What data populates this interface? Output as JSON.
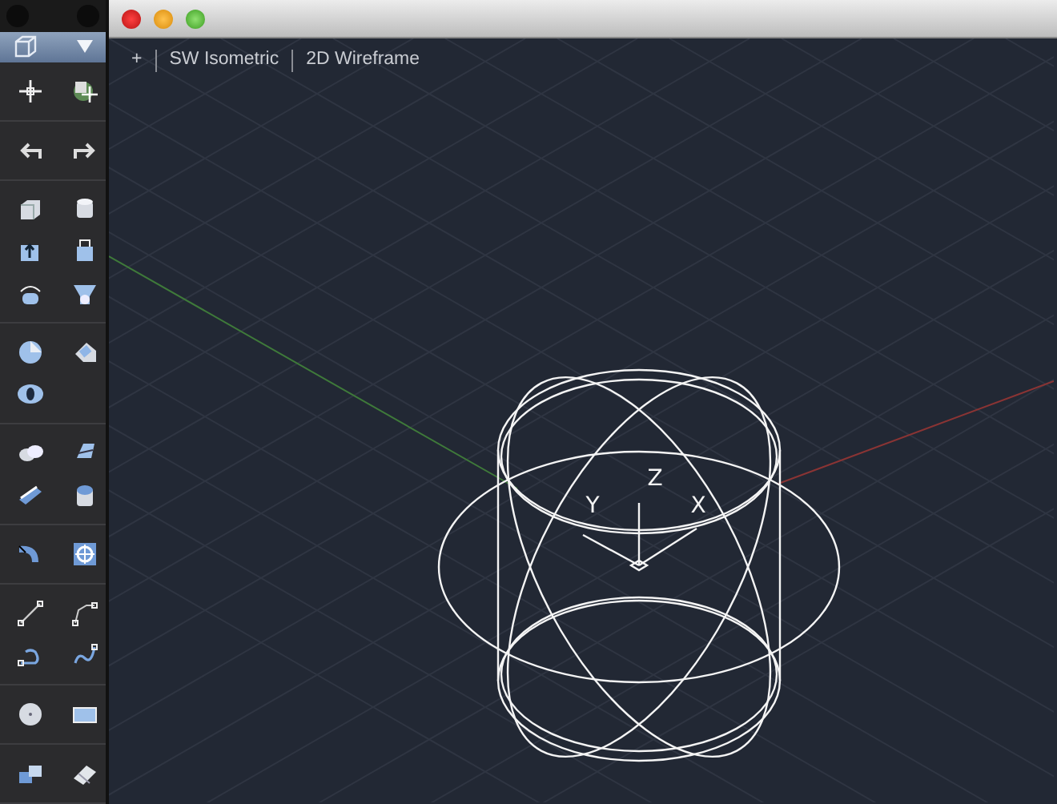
{
  "viewport_label": {
    "menu": "+",
    "view": "SW Isometric",
    "visual_style": "2D Wireframe"
  },
  "ucs_icon": {
    "labels": [
      "Z",
      "Y",
      "X"
    ]
  }
}
